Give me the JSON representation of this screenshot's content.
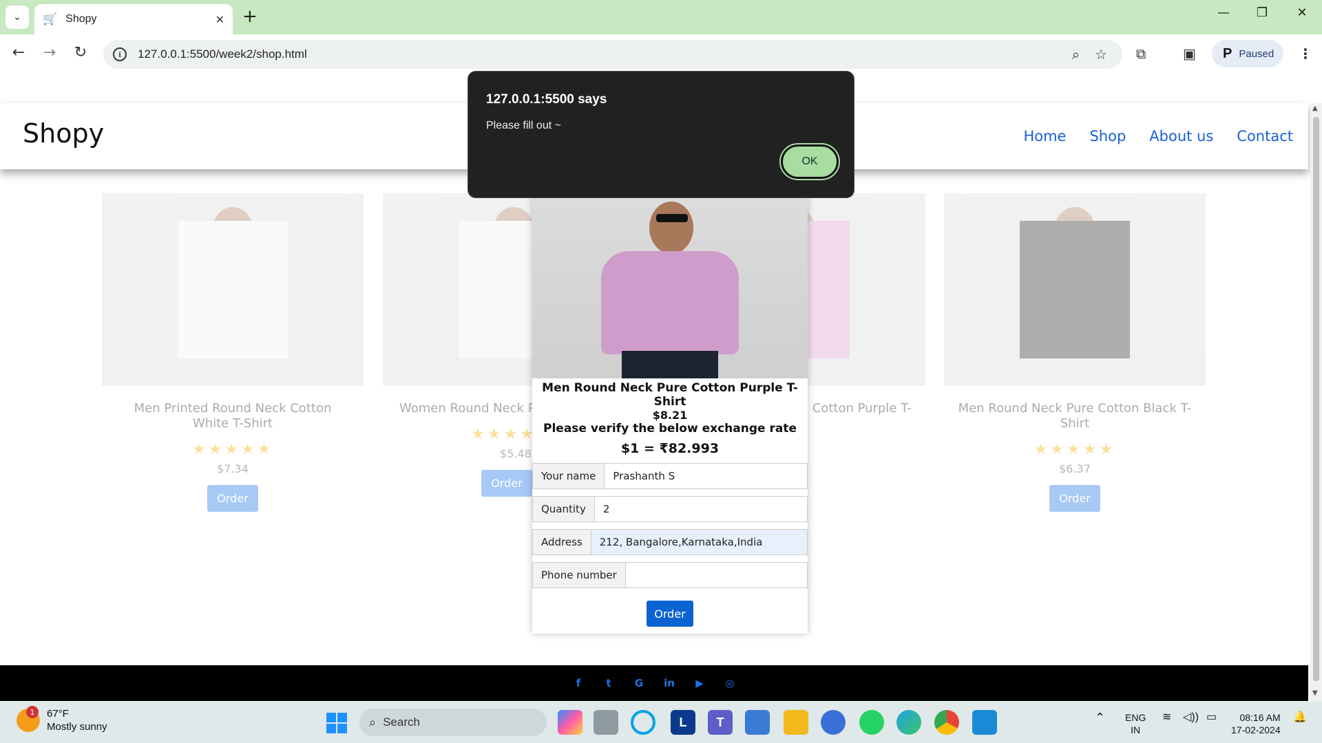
{
  "browser": {
    "tab_title": "Shopy",
    "url": "127.0.0.1:5500/week2/shop.html",
    "profile_label": "Paused"
  },
  "site": {
    "brand": "Shopy",
    "nav": [
      "Home",
      "Shop",
      "About us",
      "Contact"
    ]
  },
  "products": [
    {
      "name": "Men Printed Round Neck Cotton White T-Shirt",
      "price": "$7.34",
      "order": "Order",
      "stars": "★★★★★",
      "shirt_color": "#f4f4f2"
    },
    {
      "name": "Women Round Neck Pu T-Shirt",
      "price": "$5.48",
      "order": "Order",
      "stars": "★★★★★",
      "shirt_color": "#f0f0f0"
    },
    {
      "name": "Cotton Purple T-",
      "stars": "★★",
      "shirt_color": "#d9a0cf"
    },
    {
      "name": "Men Round Neck Pure Cotton Black T-Shirt",
      "price": "$6.37",
      "order": "Order",
      "stars": "★★★★★",
      "shirt_color": "#2b2b2b"
    }
  ],
  "modal": {
    "title": "Men Round Neck Pure Cotton Purple T-Shirt",
    "price": "$8.21",
    "verify": "Please verify the below exchange rate",
    "rate": "$1 = ₹82.993",
    "fields": [
      {
        "label": "Your name",
        "value": "Prashanth S"
      },
      {
        "label": "Quantity",
        "value": "2"
      },
      {
        "label": "Address",
        "value": "212, Bangalore,Karnataka,India"
      },
      {
        "label": "Phone number",
        "value": ""
      }
    ],
    "order_label": "Order",
    "shirt_color": "#cf9ccb"
  },
  "alert": {
    "heading": "127.0.0.1:5500 says",
    "message": "Please fill out ~",
    "ok_label": "OK"
  },
  "footer_icons": [
    "facebook-icon",
    "twitter-icon",
    "google-icon",
    "linkedin-icon",
    "youtube-icon",
    "instagram-icon"
  ],
  "footer_glyphs": [
    "f",
    "t",
    "G",
    "in",
    "▶",
    "◎"
  ],
  "taskbar": {
    "weather_badge": "1",
    "temperature": "67°F",
    "condition": "Mostly sunny",
    "search_label": "Search",
    "language_1": "ENG",
    "language_2": "IN",
    "time": "08:16 AM",
    "date": "17-02-2024"
  },
  "colors": {
    "accent": "#1a73e8",
    "tab_strip": "#c7e8c0",
    "alert_bg": "#202120",
    "ok_button": "#a8dca0"
  }
}
